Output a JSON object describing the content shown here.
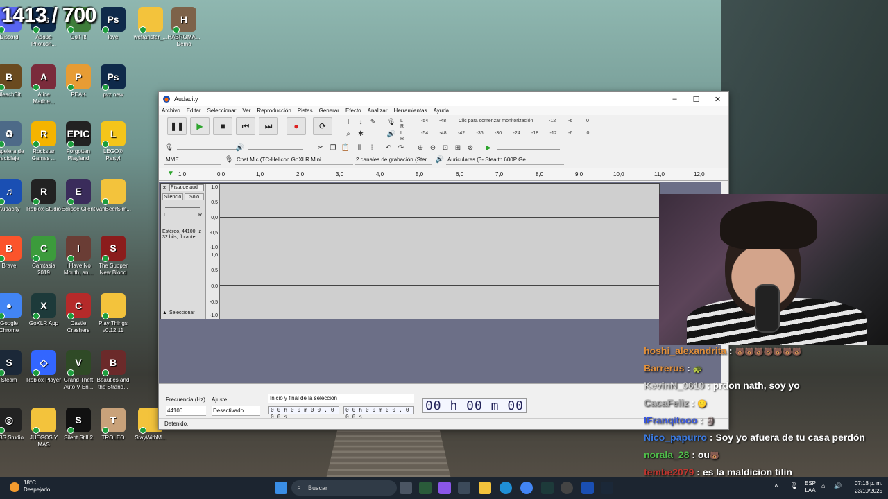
{
  "overlay": {
    "counter": "1413 / 700"
  },
  "desktop_icons": [
    {
      "label": "Discord",
      "color": "#5865f2",
      "glyph": "D"
    },
    {
      "label": "Adobe Photosh...",
      "color": "#0f2a4a",
      "glyph": "Ps"
    },
    {
      "label": "Golf It!",
      "color": "#3e7d3a",
      "glyph": "G"
    },
    {
      "label": "love",
      "color": "#0f2a4a",
      "glyph": "Ps"
    },
    {
      "label": "wetransfer_...",
      "color": "#f3c33c",
      "glyph": ""
    },
    {
      "label": "HABROMA... Demo",
      "color": "#7d6249",
      "glyph": "H"
    },
    {
      "label": "BleachBit",
      "color": "#6a4a1f",
      "glyph": "B"
    },
    {
      "label": "Alice Madne...",
      "color": "#7a2b3b",
      "glyph": "A"
    },
    {
      "label": "PEAK",
      "color": "#e79c34",
      "glyph": "P"
    },
    {
      "label": "pvz new",
      "color": "#0f2a4a",
      "glyph": "Ps"
    },
    {
      "label": "Papelera de reciclaje",
      "color": "#4d6a88",
      "glyph": "♻"
    },
    {
      "label": "Rockstar Games ...",
      "color": "#f4b400",
      "glyph": "R"
    },
    {
      "label": "Forgotten Playland",
      "color": "#222222",
      "glyph": "EPIC"
    },
    {
      "label": "LEGO® Party!",
      "color": "#f4c51a",
      "glyph": "L"
    },
    {
      "label": "Audacity",
      "color": "#1a4fb3",
      "glyph": "♫"
    },
    {
      "label": "Roblox Studio",
      "color": "#222222",
      "glyph": "R"
    },
    {
      "label": "Eclipse Client",
      "color": "#3a2c5b",
      "glyph": "E"
    },
    {
      "label": "VanBeerSim...",
      "color": "#f3c33c",
      "glyph": ""
    },
    {
      "label": "Brave",
      "color": "#fb542b",
      "glyph": "B"
    },
    {
      "label": "Camtasia 2019",
      "color": "#3c9b3c",
      "glyph": "C"
    },
    {
      "label": "I Have No Mouth, an...",
      "color": "#6a3d35",
      "glyph": "I"
    },
    {
      "label": "The Supper New Blood",
      "color": "#8b1c1c",
      "glyph": "S"
    },
    {
      "label": "Google Chrome",
      "color": "#4285f4",
      "glyph": "●"
    },
    {
      "label": "GoXLR App",
      "color": "#1d3a3a",
      "glyph": "X"
    },
    {
      "label": "Castle Crashers",
      "color": "#b52a2a",
      "glyph": "C"
    },
    {
      "label": "Play Things v0.12.11",
      "color": "#f3c33c",
      "glyph": ""
    },
    {
      "label": "Steam",
      "color": "#1b2838",
      "glyph": "S"
    },
    {
      "label": "Roblox Player",
      "color": "#3366ff",
      "glyph": "◇"
    },
    {
      "label": "Grand Theft Auto V En...",
      "color": "#2f4a26",
      "glyph": "V"
    },
    {
      "label": "Beauties and the Strand...",
      "color": "#6b2a2a",
      "glyph": "B"
    },
    {
      "label": "OBS Studio",
      "color": "#222222",
      "glyph": "◎"
    },
    {
      "label": "JUEGOS Y MAS",
      "color": "#f3c33c",
      "glyph": ""
    },
    {
      "label": "Silent Still 2",
      "color": "#111111",
      "glyph": "S"
    },
    {
      "label": "TROLEO",
      "color": "#c9a27a",
      "glyph": "T"
    },
    {
      "label": "StayWithM...",
      "color": "#f3c33c",
      "glyph": ""
    }
  ],
  "audacity": {
    "title": "Audacity",
    "menu": [
      "Archivo",
      "Editar",
      "Seleccionar",
      "Ver",
      "Reproducción",
      "Pistas",
      "Generar",
      "Efecto",
      "Analizar",
      "Herramientas",
      "Ayuda"
    ],
    "meter_hint": "Clic para comenzar monitorización",
    "meter_ticks_rec": [
      "-54",
      "-48",
      "-12",
      "-6",
      "0"
    ],
    "meter_ticks_play": [
      "-54",
      "-48",
      "-42",
      "-36",
      "-30",
      "-24",
      "-18",
      "-12",
      "-6",
      "0"
    ],
    "host": "MME",
    "rec_device": "Chat Mic (TC-Helicon GoXLR Mini",
    "channels": "2 canales de grabación (Ster",
    "play_device": "Auriculares (3- Stealth 600P Ge",
    "ruler": [
      "1,0",
      "0,0",
      "1,0",
      "2,0",
      "3,0",
      "4,0",
      "5,0",
      "6,0",
      "7,0",
      "8,0",
      "9,0",
      "10,0",
      "11,0",
      "12,0"
    ],
    "track": {
      "name": "Pista de audi",
      "mute": "Silencio",
      "solo": "Solo",
      "info1": "Estéreo, 44100Hz",
      "info2": "32 bits, flotante",
      "select": "Seleccionar",
      "pan_l": "L",
      "pan_r": "R",
      "scale": [
        "1,0",
        "0,5",
        "0,0",
        "-0,5",
        "-1,0",
        "1,0",
        "0,5",
        "0,0",
        "-0,5",
        "-1,0"
      ]
    },
    "bottom": {
      "rate_label": "Frecuencia (Hz)",
      "rate_value": "44100",
      "snap_label": "Ajuste",
      "snap_value": "Desactivado",
      "selection_mode": "Inicio y final de la selección",
      "sel_start": "0 0 h 0 0 m 0 0 . 0 0 0 s",
      "sel_end": "0 0 h 0 0 m 0 0 . 0 0 0 s",
      "time": "00 h 00 m 00 s"
    },
    "status": "Detenido."
  },
  "chat": [
    {
      "user": "hoshi_alexandrita",
      "text": "",
      "color": "#e2903a",
      "emote": "🐻🐻🐻🐻🐻🐻🐻"
    },
    {
      "user": "Barrerus",
      "text": "",
      "color": "#e2903a",
      "emote": "🐢"
    },
    {
      "user": "KevinN_0610",
      "text": "prdon nath, soy yo",
      "color": "#d5d5d5",
      "emote": ""
    },
    {
      "user": "CacaFeliz",
      "text": "",
      "color": "#b0b0b0",
      "emote": "😐"
    },
    {
      "user": "IFranqitooo",
      "text": "",
      "color": "#3b58e0",
      "emote": "🗿"
    },
    {
      "user": "Nico_papurro",
      "text": "Soy yo afuera de tu casa perdón",
      "color": "#3b7ae0",
      "emote": ""
    },
    {
      "user": "norala_28",
      "text": "ou",
      "color": "#4fbf4a",
      "emote": "🐻"
    },
    {
      "user": "tembe2079",
      "text": "es la maldicion tilin",
      "color": "#c0352f",
      "emote": ""
    }
  ],
  "taskbar": {
    "temp": "18°C",
    "weather": "Despejado",
    "search_placeholder": "Buscar",
    "lang1": "ESP",
    "lang2": "LAA",
    "time": "07:18 p. m.",
    "date": "23/10/2025"
  }
}
